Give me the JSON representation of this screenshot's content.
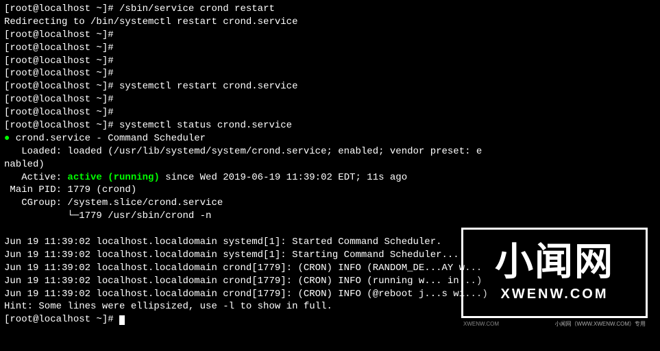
{
  "prompt_prefix": "[root@localhost ~]# ",
  "lines": {
    "cmd1": "/sbin/service crond restart",
    "redirect": "Redirecting to /bin/systemctl restart crond.service",
    "cmd2": "systemctl restart crond.service",
    "cmd3": "systemctl status crond.service",
    "svc_header": " crond.service - Command Scheduler",
    "loaded": "   Loaded: loaded (/usr/lib/systemd/system/crond.service; enabled; vendor preset: e",
    "loaded2": "nabled)",
    "active_label": "   Active: ",
    "active_status": "active (running)",
    "active_tail": " since Wed 2019-06-19 11:39:02 EDT; 11s ago",
    "mainpid": " Main PID: 1779 (crond)",
    "cgroup": "   CGroup: /system.slice/crond.service",
    "cgroup2": "           └─1779 /usr/sbin/crond -n",
    "log1": "Jun 19 11:39:02 localhost.localdomain systemd[1]: Started Command Scheduler.",
    "log2": "Jun 19 11:39:02 localhost.localdomain systemd[1]: Starting Command Scheduler...",
    "log3": "Jun 19 11:39:02 localhost.localdomain crond[1779]: (CRON) INFO (RANDOM_DE...AY w...",
    "log4": "Jun 19 11:39:02 localhost.localdomain crond[1779]: (CRON) INFO (running w... in...)",
    "log5": "Jun 19 11:39:02 localhost.localdomain crond[1779]: (CRON) INFO (@reboot j...s wi...)",
    "hint": "Hint: Some lines were ellipsized, use -l to show in full."
  },
  "watermark": {
    "main": "小闻网",
    "sub": "XWENW.COM",
    "tiny_right": "小闻网（WWW.XWENW.COM）专用",
    "tiny_left": "XWENW.COM"
  }
}
